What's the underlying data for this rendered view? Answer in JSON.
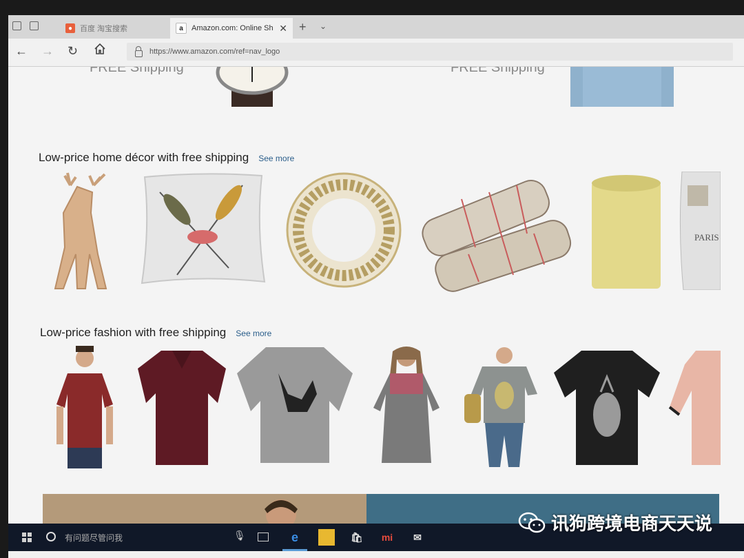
{
  "browser": {
    "tabs": [
      {
        "label": "百度 淘宝搜索",
        "active": false
      },
      {
        "label": "Amazon.com: Online Sh",
        "active": true
      }
    ],
    "url": "https://www.amazon.com/ref=nav_logo",
    "new_tab_label": "+",
    "tab_menu_label": "⌄"
  },
  "page": {
    "top_partial_left": "FREE Shipping",
    "top_partial_right": "FREE Shipping",
    "sections": [
      {
        "title": "Low-price home décor with free shipping",
        "see_more": "See more",
        "items": [
          "deer-figurine",
          "feather-pillow",
          "decorative-plate",
          "sage-bundles",
          "yellow-candle",
          "paris-pillow"
        ]
      },
      {
        "title": "Low-price fashion with free shipping",
        "see_more": "See more",
        "items": [
          "man-red-tshirt",
          "maroon-polo",
          "gray-graphic-tee",
          "floral-top",
          "pineapple-tee-woman",
          "black-pineapple-tee",
          "pink-tee"
        ]
      }
    ]
  },
  "taskbar": {
    "search_placeholder": "有问题尽管问我"
  },
  "watermark": {
    "text": "讯狗跨境电商天天说"
  },
  "colors": {
    "tab_bar": "#d6d6d6",
    "page_bg": "#f4f4f4",
    "taskbar": "#101828",
    "link": "#2a5d8a"
  }
}
